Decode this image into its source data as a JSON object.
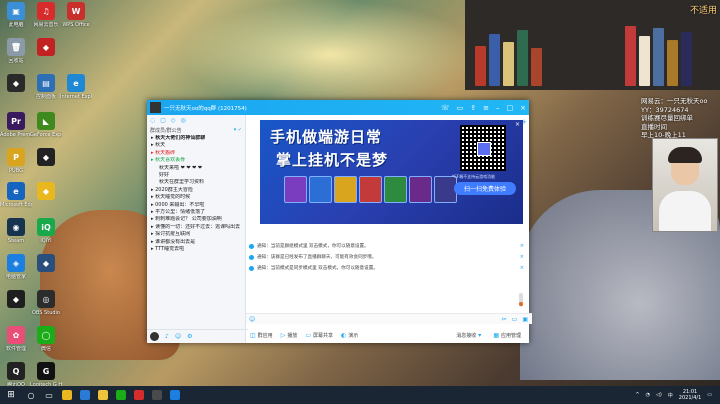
{
  "overlay": {
    "corner_text": "不适用",
    "stream_lines": [
      "网易云：一只无秋天oo",
      "YY：39724674",
      "训练赛尽量回绑单",
      "直播时间",
      "早上10-晚上11"
    ]
  },
  "desktop_icons": [
    {
      "label": "此电脑",
      "icon": "computer-icon",
      "color": "#3b8fd6",
      "glyph": "▣"
    },
    {
      "label": "网易云音乐",
      "icon": "netease-music-icon",
      "color": "#d72c2c",
      "glyph": "♫"
    },
    {
      "label": "WPS Office",
      "icon": "wps-icon",
      "color": "#c9302c",
      "glyph": "W"
    },
    {
      "label": "回收站",
      "icon": "recycle-bin-icon",
      "color": "#8a9aa8",
      "glyph": "🗑"
    },
    {
      "label": "",
      "icon": "app-icon",
      "color": "#c32222",
      "glyph": "◆"
    },
    {
      "label": "",
      "icon": "app-icon",
      "color": "#2a2a2a",
      "glyph": "◆"
    },
    {
      "label": "控制面板",
      "icon": "control-panel-icon",
      "color": "#2d6fb7",
      "glyph": "▤"
    },
    {
      "label": "Internet Explorer",
      "icon": "ie-icon",
      "color": "#1e88d4",
      "glyph": "e"
    },
    {
      "label": "Adobe Premiere",
      "icon": "premiere-icon",
      "color": "#3a1a5e",
      "glyph": "Pr"
    },
    {
      "label": "GeForce Experience",
      "icon": "nvidia-icon",
      "color": "#3e8a1e",
      "glyph": "◣"
    },
    {
      "label": "PUBG",
      "icon": "pubg-icon",
      "color": "#d9a41e",
      "glyph": "P"
    },
    {
      "label": "",
      "icon": "app-icon",
      "color": "#222222",
      "glyph": "◆"
    },
    {
      "label": "Microsoft Edge",
      "icon": "edge-icon",
      "color": "#1565c0",
      "glyph": "e"
    },
    {
      "label": "",
      "icon": "app-icon",
      "color": "#e8b81e",
      "glyph": "◆"
    },
    {
      "label": "Steam",
      "icon": "steam-icon",
      "color": "#16344f",
      "glyph": "◉"
    },
    {
      "label": "iQIYI",
      "icon": "iqiyi-icon",
      "color": "#19a84a",
      "glyph": "iQ"
    },
    {
      "label": "电脑管家",
      "icon": "pc-manager-icon",
      "color": "#1a7fe0",
      "glyph": "◈"
    },
    {
      "label": "",
      "icon": "app-icon",
      "color": "#2b4f7c",
      "glyph": "◆"
    },
    {
      "label": "",
      "icon": "app-icon",
      "color": "#1e1e1e",
      "glyph": "◆"
    },
    {
      "label": "OBS Studio",
      "icon": "obs-icon",
      "color": "#2c2c2c",
      "glyph": "◎"
    },
    {
      "label": "软件管理",
      "icon": "software-manager-icon",
      "color": "#e94e77",
      "glyph": "✿"
    },
    {
      "label": "微信",
      "icon": "wechat-icon",
      "color": "#1aad19",
      "glyph": "◯"
    },
    {
      "label": "腾讯QQ",
      "icon": "qq-icon",
      "color": "#222222",
      "glyph": "Q"
    },
    {
      "label": "Logitech G HUB",
      "icon": "logitech-icon",
      "color": "#111111",
      "glyph": "G"
    }
  ],
  "qq": {
    "window_title": "一只无秋天oo的qq群 (1201754)",
    "sidebar_header": "群成员/群公告",
    "sidebar_items": [
      {
        "text": "秋天大佬们的神仙群聊",
        "style": "bold"
      },
      {
        "text": "秋天",
        "style": "normal"
      },
      {
        "text": "秋天搬砖",
        "style": "red"
      },
      {
        "text": "秋天喜欢丢骨",
        "style": "green"
      },
      {
        "text": "秋天来啦 ❤ ❤ ❤ ❤",
        "style": "indent"
      },
      {
        "text": "好好",
        "style": "indent"
      },
      {
        "text": "秋天在群里学习资料",
        "style": "indent"
      },
      {
        "text": "2020群主大冒险",
        "style": "normal"
      },
      {
        "text": "秋天睡觉的时候",
        "style": "normal"
      },
      {
        "text": "0000 来输出：不早啦",
        "style": "normal"
      },
      {
        "text": "平方公里：情绪低落了",
        "style": "normal"
      },
      {
        "text": "刺刺难题会记？ 公司要加油啊",
        "style": "normal"
      },
      {
        "text": "读懂的一切：还好不过去：逃课吗出去",
        "style": "normal"
      },
      {
        "text": "探讨抗疫互联网",
        "style": "normal"
      },
      {
        "text": "谁讲都没有出去是",
        "style": "normal"
      },
      {
        "text": "TTT睡觉去啦",
        "style": "normal"
      }
    ],
    "ad": {
      "headline1": "手机做端游日常",
      "headline2": "掌上挂机不是梦",
      "note": "*CF端不支持云游戏功能",
      "cta": "扫一扫免费体验",
      "close": "×"
    },
    "messages": [
      "通知：当前是群组模式里 双击模式，你可以随意设置。",
      "通知：该群是已经发布了直播群聊天，可能有效会同步哦。",
      "通知：当前模式是同步模式里 双击模式，你可以随意设置。"
    ],
    "bottom": {
      "b1": "群应用",
      "b2": "播放",
      "b3": "屏幕共享",
      "b4": "演示",
      "b5": "消息接收",
      "b6": "应用管理"
    }
  },
  "taskbar": {
    "time": "21:01",
    "date": "2021/4/1",
    "apps": [
      "#e8b81e",
      "#2a7ad6",
      "#f0c33c",
      "#1aad19",
      "#d72c2c",
      "#4a4a4a",
      "#1a7fe0"
    ]
  }
}
